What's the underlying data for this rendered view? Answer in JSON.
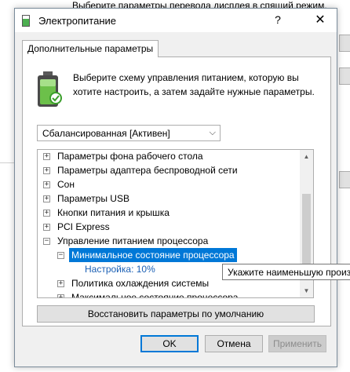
{
  "background": {
    "top_text": "Выберите параметры перевода дисплея в спящий режим."
  },
  "dialog": {
    "title": "Электропитание",
    "help_label": "?",
    "close_label": "✕",
    "tab_label": "Дополнительные параметры",
    "description": "Выберите схему управления питанием, которую вы хотите настроить, а затем задайте нужные параметры.",
    "plan_select": {
      "value": "Сбалансированная [Активен]",
      "chevron": "⌵"
    },
    "tree": {
      "items": [
        {
          "label": "Параметры фона рабочего стола",
          "expander": "+"
        },
        {
          "label": "Параметры адаптера беспроводной сети",
          "expander": "+"
        },
        {
          "label": "Сон",
          "expander": "+"
        },
        {
          "label": "Параметры USB",
          "expander": "+"
        },
        {
          "label": "Кнопки питания и крышка",
          "expander": "+"
        },
        {
          "label": "PCI Express",
          "expander": "+"
        },
        {
          "label": "Управление питанием процессора",
          "expander": "−"
        },
        {
          "label": "Минимальное состояние процессора",
          "expander": "−"
        },
        {
          "label": "Настройка: 10%"
        },
        {
          "label": "Политика охлаждения системы",
          "expander": "+"
        },
        {
          "label": "Максимальное состояние процессора",
          "expander": "+"
        }
      ],
      "scroll_up": "▲",
      "scroll_down": "▼"
    },
    "tooltip": "Укажите наименьшую произ",
    "restore_button": "Восстановить параметры по умолчанию",
    "ok_button": "OK",
    "cancel_button": "Отмена",
    "apply_button": "Применить"
  },
  "colors": {
    "accent": "#0078d7",
    "dialog_bg": "#f0f0f0"
  }
}
